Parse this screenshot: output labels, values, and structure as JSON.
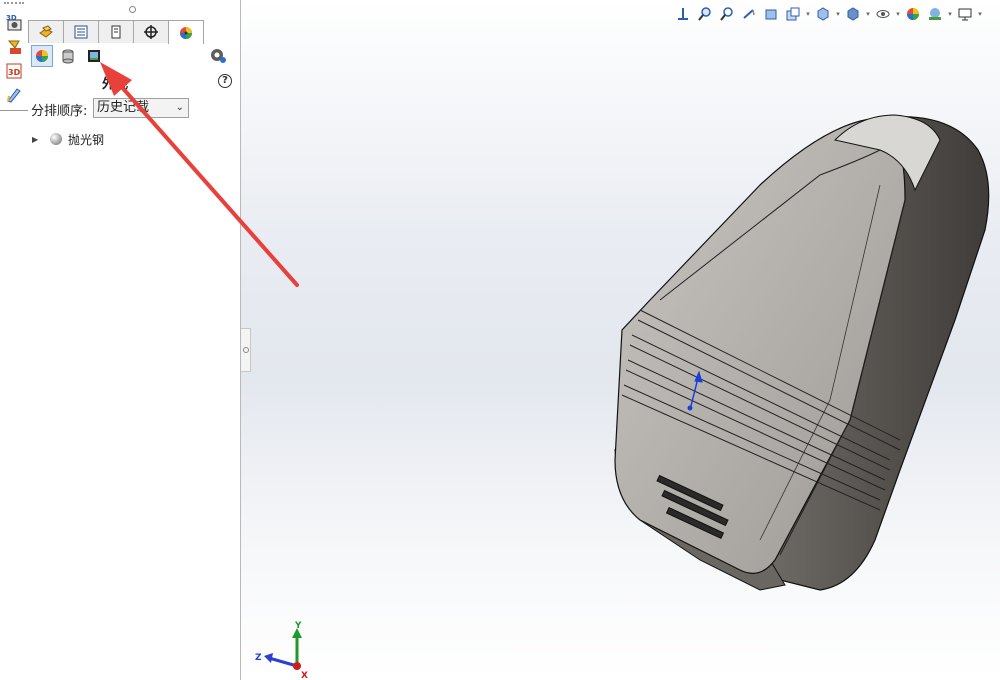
{
  "panel": {
    "section_title": "外观",
    "help_glyph": "?",
    "sort_label": "分排顺序:",
    "sort_value": "历史记载",
    "tree_items": [
      {
        "label": "抛光钢",
        "icon": "sphere-material-icon"
      }
    ]
  },
  "tabs": [
    "feature-manager-tab",
    "property-manager-tab",
    "configuration-manager-tab",
    "dimxpert-manager-tab",
    "display-manager-tab"
  ],
  "sidebar_buttons": [
    "3d-view-icon",
    "render-tool-icon",
    "3d-drawing-icon",
    "sketch-tool-icon"
  ],
  "display_subicons": [
    "appearances-icon",
    "decals-icon",
    "scene-icon"
  ],
  "view_toolbar": [
    "view-orientation-icon",
    "zoom-to-fit-icon",
    "zoom-area-icon",
    "previous-view-icon",
    "section-view-icon",
    "dynamic-annotation-icon",
    "view-orientation-cube-icon",
    "display-style-icon",
    "hide-show-icon",
    "edit-appearance-icon",
    "apply-scene-icon",
    "view-settings-icon"
  ],
  "triad": {
    "x": "X",
    "y": "Y",
    "z": "Z"
  },
  "colors": {
    "accent_arrow": "#e8403a",
    "triad_x": "#d21a1a",
    "triad_y": "#1f9a2a",
    "triad_z": "#2c3fd0",
    "model_face": "#b4b0ab"
  }
}
